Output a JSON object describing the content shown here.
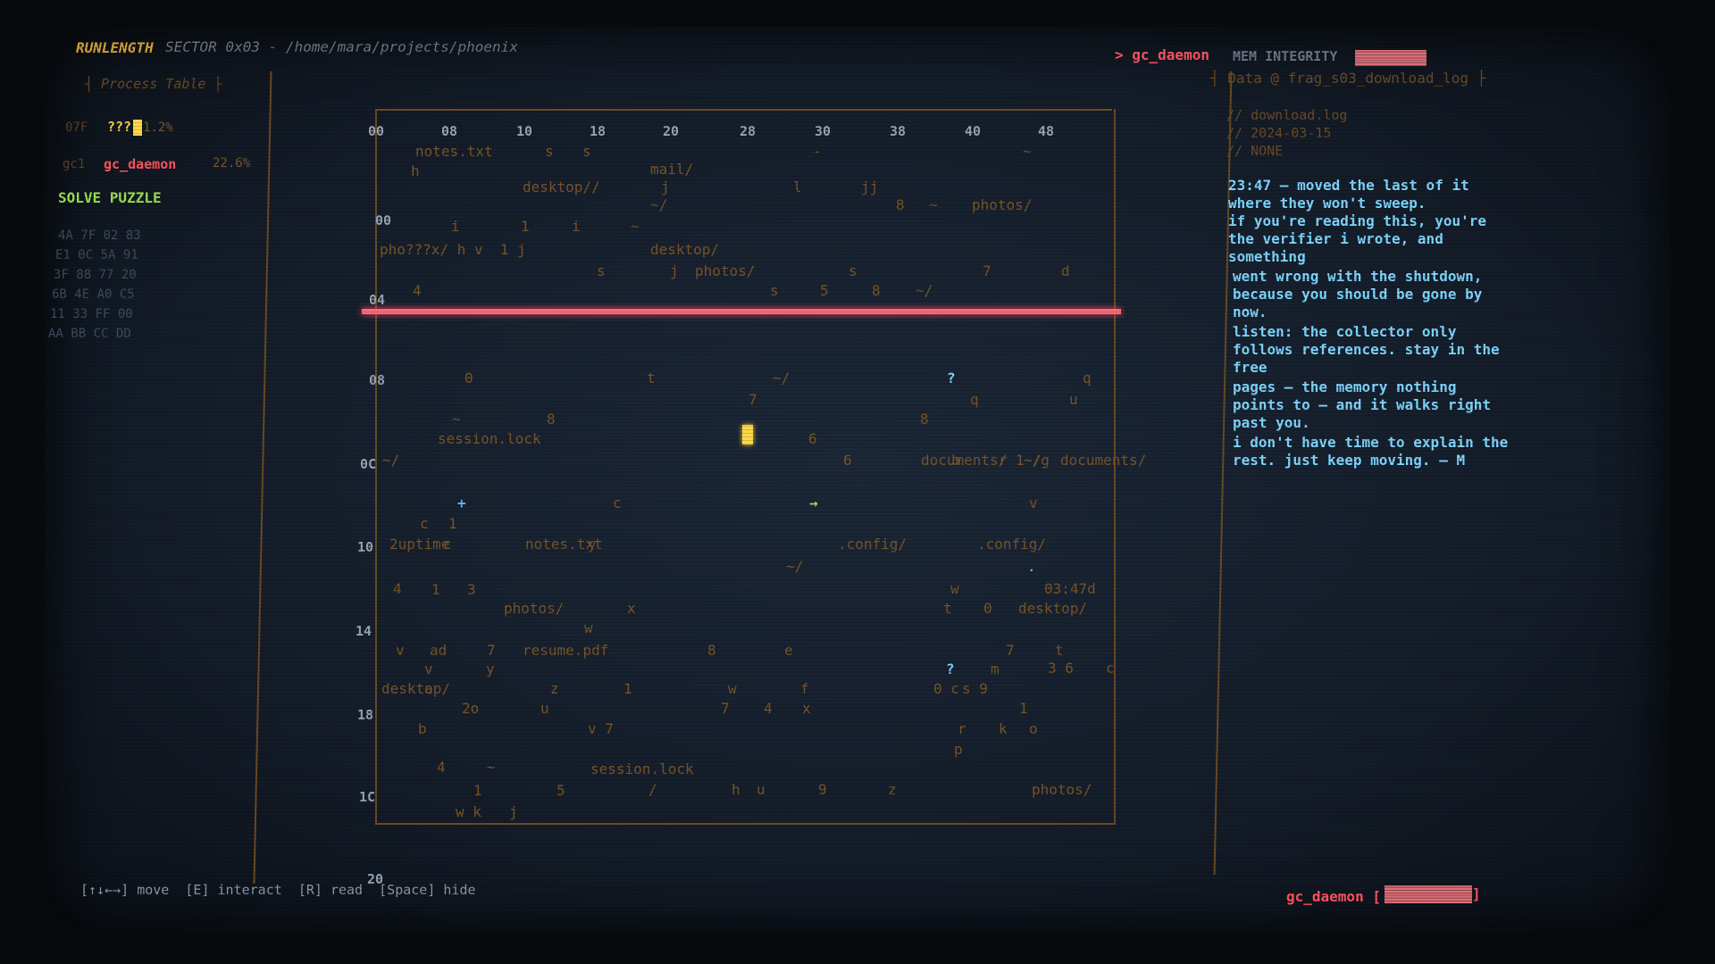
{
  "header": {
    "title": "RUNLENGTH",
    "sector": "SECTOR 0x03 - /home/mara/projects/phoenix",
    "active_process": "> gc_daemon",
    "mem_integrity_label": "MEM INTEGRITY"
  },
  "process_table": {
    "title": "┤ Process Table ├",
    "rows": [
      {
        "id": "07F",
        "name": "???",
        "pct": "1.2%"
      },
      {
        "id": "gc1",
        "name": "gc_daemon",
        "pct": "22.6%"
      }
    ],
    "solve_label": "SOLVE PUZZLE",
    "hex_dump": [
      "4A 7F 02 83",
      "E1 0C 5A 91",
      "3F 88 77 20",
      "6B 4E A0 C5",
      "11 33 FF 00",
      "AA BB CC DD"
    ]
  },
  "grid": {
    "column_headers": [
      "00",
      "08",
      "10",
      "18",
      "20",
      "28",
      "30",
      "38",
      "40",
      "48"
    ],
    "row_headers": [
      "00",
      "04",
      "08",
      "0C",
      "10",
      "14",
      "18",
      "1C",
      "20"
    ],
    "fragments": [
      "notes.txt",
      "s",
      "s",
      "-",
      "~",
      "mail/",
      "h",
      "desktop//",
      "j",
      "l",
      "jj",
      "~/",
      "8",
      "~",
      "photos/",
      "i",
      "1",
      "i",
      "~",
      "pho???x/ h v  1 j",
      "desktop/",
      "s",
      "j",
      "photos/",
      "s",
      "7",
      "d",
      "4",
      "s",
      "5",
      "8",
      "~/",
      "0",
      "t",
      "~/",
      "?",
      "q",
      "7",
      "q",
      "u",
      "~",
      "8",
      "8",
      "session.lock",
      "6",
      "~/",
      "6",
      "documents/ 1 /",
      "b",
      "r",
      "~/g",
      "documents/",
      "+",
      "c",
      "→",
      "v",
      "c",
      "1",
      "2uptime",
      "c",
      "notes.txt",
      "y",
      ".config/",
      ".config/",
      "~/",
      ".",
      "4",
      "1",
      "3",
      "w",
      "03:47d",
      "photos/",
      "x",
      "t",
      "0",
      "desktop/",
      "w",
      "v",
      "ad",
      "7",
      "resume.pdf",
      "8",
      "e",
      "7",
      "t",
      "v",
      "y",
      "?",
      "m",
      "3 6",
      "c",
      "desktop/",
      "a",
      "z",
      "1",
      "w",
      "f",
      "0 c",
      "s 9",
      "2o",
      "u",
      "7",
      "4",
      "x",
      "1",
      "b",
      "v 7",
      "r",
      "k",
      "o",
      "p",
      "4",
      "~",
      "session.lock",
      "1",
      "5",
      "/",
      "h",
      "u",
      "9",
      "z",
      "photos/",
      "w k",
      "j"
    ]
  },
  "data_panel": {
    "title": "┤ Data @ frag_s03_download_log ├",
    "meta": [
      "// download.log",
      "// 2024-03-15",
      "// NONE"
    ],
    "log_lines": [
      "23:47 — moved the last of it",
      "where they won't sweep.",
      "if you're reading this, you're",
      "the verifier i wrote, and",
      "something",
      "went wrong with the shutdown,",
      "because you should be gone by",
      "now.",
      "listen: the collector only",
      "follows references. stay in the",
      "free",
      "pages — the memory nothing",
      "points to — and it walks right",
      "past you.",
      "i don't have time to explain the",
      "rest. just keep moving. — M"
    ]
  },
  "footer": {
    "controls": "[↑↓←→] move  [E] interact  [R] read  [Space] hide",
    "daemon_label": "gc_daemon [",
    "daemon_bracket_close": "]"
  },
  "colors": {
    "accent_orange": "#d08f3a",
    "danger_red": "#ff5560",
    "terminal_cyan": "#7ed6ff",
    "puzzle_green": "#9ee350",
    "player_yellow": "#ffd84a"
  }
}
